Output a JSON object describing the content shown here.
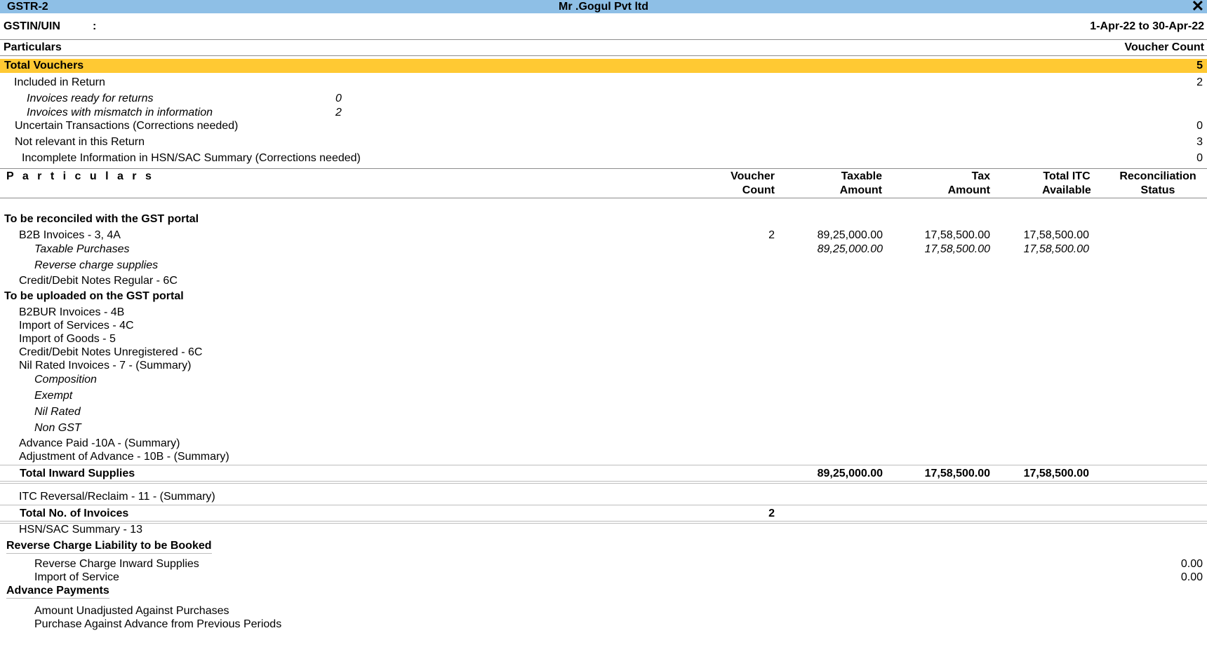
{
  "window": {
    "report_name": "GSTR-2",
    "company": "Mr .Gogul Pvt ltd",
    "close_glyph": "✕"
  },
  "header": {
    "gstin_label": "GSTIN/UIN",
    "gstin_colon": ":",
    "period": "1-Apr-22 to 30-Apr-22",
    "particulars_label": "Particulars",
    "voucher_count_label": "Voucher Count"
  },
  "summary": {
    "total_vouchers": {
      "label": "Total Vouchers",
      "value": "5"
    },
    "included_in_return": {
      "label": "Included in Return",
      "value": "2"
    },
    "invoices_ready": {
      "label": "Invoices ready for returns",
      "value": "0"
    },
    "invoices_mismatch": {
      "label": "Invoices with mismatch in information",
      "value": "2"
    },
    "uncertain": {
      "label": "Uncertain Transactions (Corrections needed)",
      "value": "0"
    },
    "not_relevant": {
      "label": "Not relevant in this Return",
      "value": "3"
    },
    "incomplete_hsn": {
      "label": "Incomplete Information in HSN/SAC Summary (Corrections needed)",
      "value": "0"
    }
  },
  "table_header": {
    "particulars": "P a r t i c u l a r s",
    "voucher_count_1": "Voucher",
    "voucher_count_2": "Count",
    "taxable_1": "Taxable",
    "taxable_2": "Amount",
    "tax_1": "Tax",
    "tax_2": "Amount",
    "itc_1": "Total ITC",
    "itc_2": "Available",
    "recon_1": "Reconciliation",
    "recon_2": "Status"
  },
  "sections": {
    "reconcile_heading": "To be reconciled with the GST portal",
    "b2b": {
      "label": "B2B Invoices - 3, 4A",
      "count": "2",
      "taxable": "89,25,000.00",
      "tax": "17,58,500.00",
      "itc": "17,58,500.00"
    },
    "taxable_purchases": {
      "label": "Taxable Purchases",
      "taxable": "89,25,000.00",
      "tax": "17,58,500.00",
      "itc": "17,58,500.00"
    },
    "reverse_charge_supplies": "Reverse charge supplies",
    "cdn_regular": "Credit/Debit Notes Regular - 6C",
    "upload_heading": "To be uploaded on the GST portal",
    "b2bur": "B2BUR Invoices - 4B",
    "import_services": "Import of Services - 4C",
    "import_goods": "Import of Goods - 5",
    "cdn_unregistered": "Credit/Debit Notes Unregistered - 6C",
    "nil_rated_invoices": "Nil Rated Invoices - 7 - (Summary)",
    "composition": "Composition",
    "exempt": "Exempt",
    "nil_rated": "Nil Rated",
    "non_gst": "Non GST",
    "advance_paid": "Advance Paid -10A - (Summary)",
    "adjustment_advance": "Adjustment of Advance - 10B - (Summary)",
    "total_inward": {
      "label": "Total Inward Supplies",
      "taxable": "89,25,000.00",
      "tax": "17,58,500.00",
      "itc": "17,58,500.00"
    },
    "itc_reversal": "ITC Reversal/Reclaim - 11 - (Summary)",
    "total_invoices": {
      "label": "Total No. of Invoices",
      "count": "2"
    },
    "hsn_summary": "HSN/SAC Summary - 13"
  },
  "reverse_charge": {
    "heading": "Reverse Charge Liability to be Booked",
    "inward": {
      "label": "Reverse Charge Inward Supplies",
      "value": "0.00"
    },
    "import_service": {
      "label": "Import of Service",
      "value": "0.00"
    }
  },
  "advance_payments": {
    "heading": "Advance Payments",
    "unadjusted": "Amount Unadjusted Against Purchases",
    "purchase_against": "Purchase Against Advance from Previous Periods"
  }
}
